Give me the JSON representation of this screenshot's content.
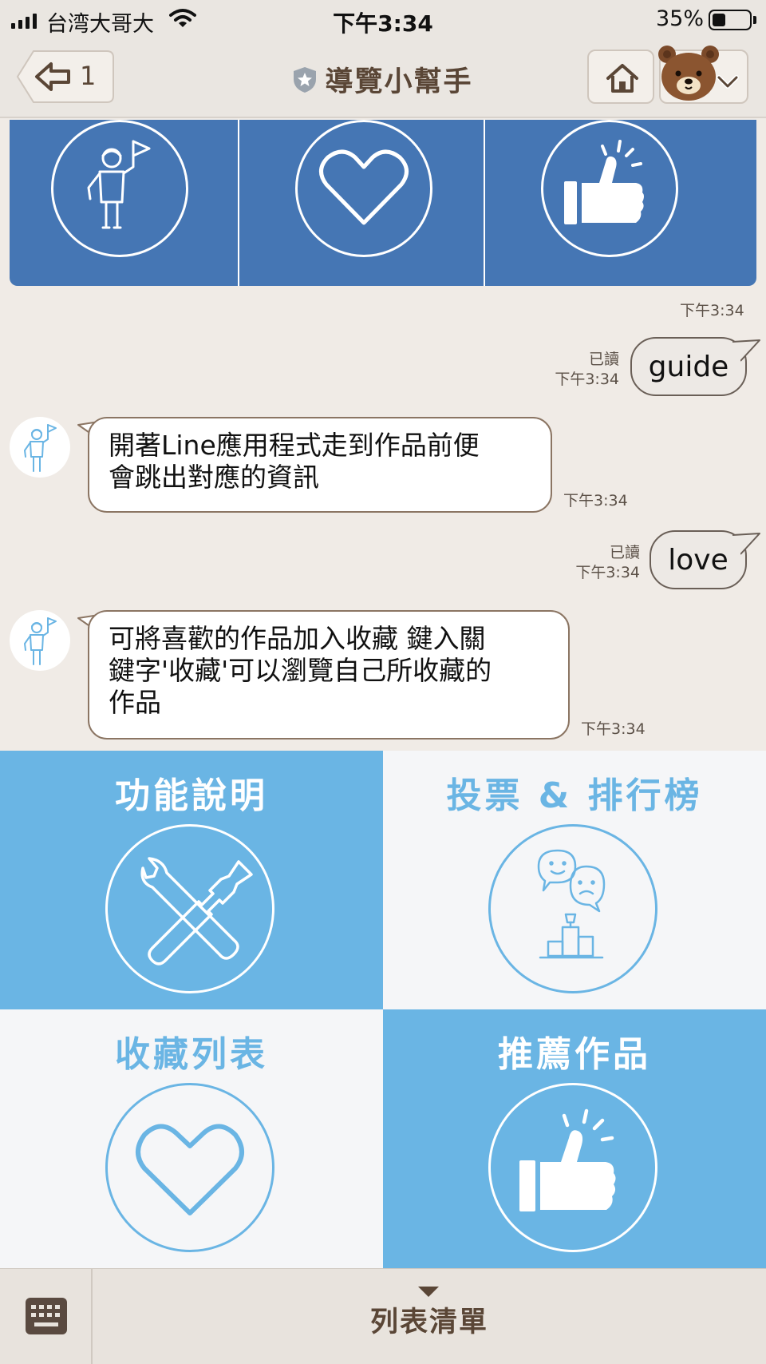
{
  "status_bar": {
    "carrier": "台湾大哥大",
    "time": "下午3:34",
    "battery_percent": "35%",
    "battery_level": 0.35
  },
  "header": {
    "back_count": "1",
    "title": "導覽小幫手",
    "icons": [
      "back-arrow-icon",
      "shield-star-icon",
      "home-icon",
      "bear-avatar-icon",
      "chevron-down-icon"
    ]
  },
  "card": {
    "timestamp": "下午3:34",
    "icons": [
      "guide-person-flag-icon",
      "heart-icon",
      "thumbs-up-icon"
    ]
  },
  "messages": [
    {
      "side": "out",
      "text": "guide",
      "read": "已讀",
      "time": "下午3:34"
    },
    {
      "side": "in",
      "lines": [
        "開著Line應用程式走到作品前便",
        "會跳出對應的資訊"
      ],
      "time": "下午3:34"
    },
    {
      "side": "out",
      "text": "love",
      "read": "已讀",
      "time": "下午3:34"
    },
    {
      "side": "in",
      "lines": [
        "可將喜歡的作品加入收藏 鍵入關",
        "鍵字'收藏'可以瀏覽自己所收藏的",
        "作品"
      ],
      "time": "下午3:34"
    }
  ],
  "rich_menu": {
    "items": [
      {
        "label": "功能說明",
        "icon": "tools-icon"
      },
      {
        "label": "投票 & 排行榜",
        "icon": "vote-ranking-icon"
      },
      {
        "label": "收藏列表",
        "icon": "heart-icon"
      },
      {
        "label": "推薦作品",
        "icon": "thumbs-up-icon"
      }
    ]
  },
  "bottom_bar": {
    "menu_label": "列表清單",
    "icons": [
      "keyboard-icon",
      "caret-down-icon"
    ]
  },
  "colors": {
    "card_blue": "#4576b4",
    "menu_blue": "#6ab5e4",
    "menu_white": "#f5f6f8",
    "chat_bg": "#f0ebe6",
    "header_text": "#5a4636"
  }
}
